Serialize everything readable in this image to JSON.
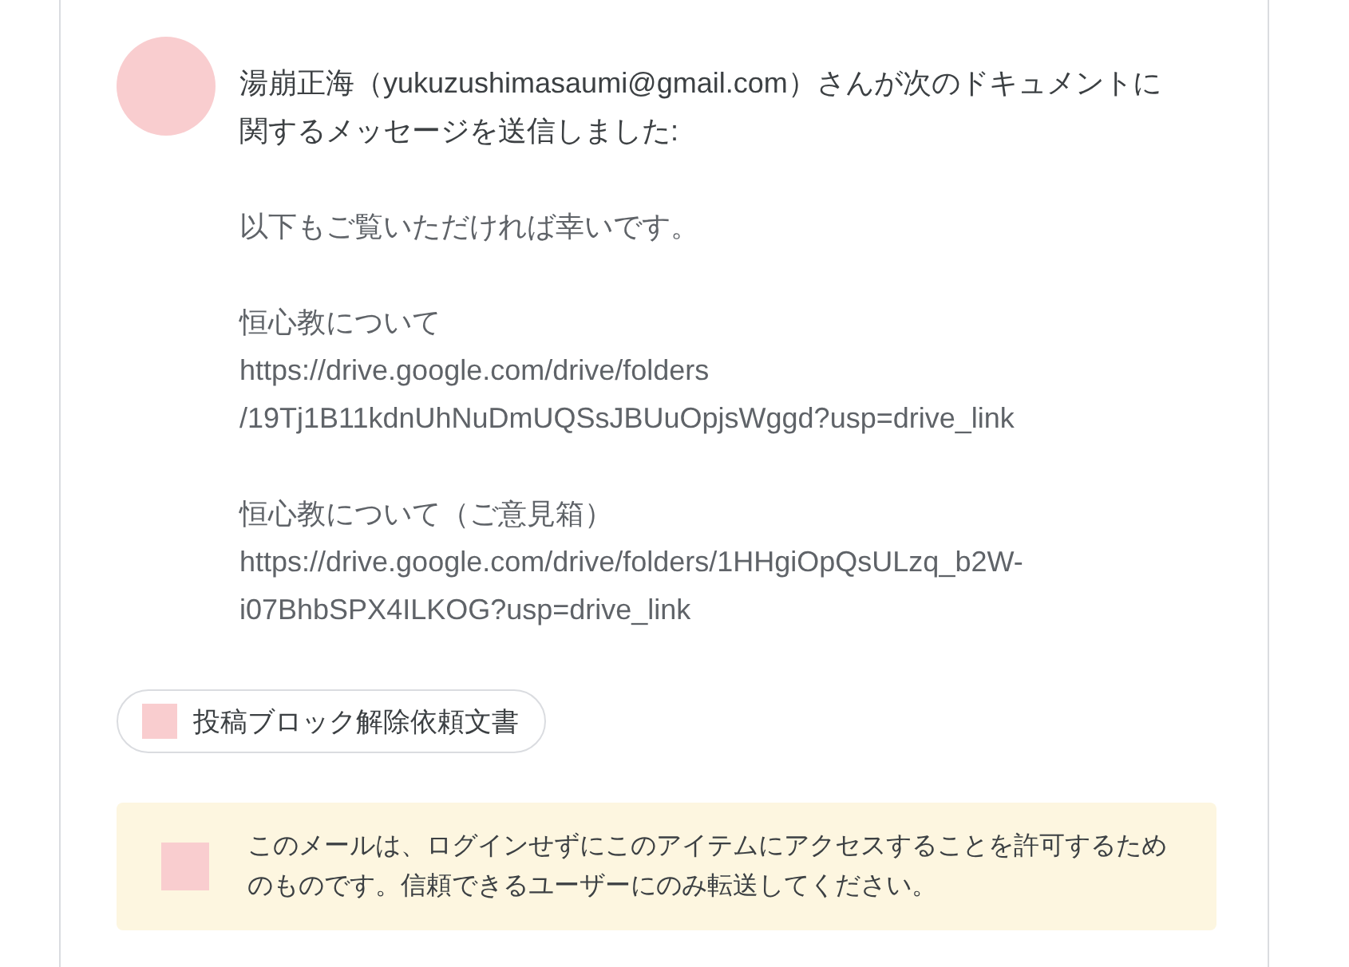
{
  "header": {
    "lines": [
      "湯崩正海（yukuzushimasaumi@gmail.com）さんが次のドキュメントに",
      "関するメッセージを送信しました:"
    ]
  },
  "message": {
    "paragraphs": [
      {
        "texts": [
          {
            "lines": [
              "以下もご覧いただければ幸いです。"
            ]
          }
        ]
      },
      {
        "texts": [
          {
            "lines": [
              "恒心教について"
            ]
          },
          {
            "lines": [
              "https://drive.google.com/drive/folders",
              "/19Tj1B11kdnUhNuDmUQSsJBUuOpjsWggd?usp=drive_link"
            ]
          }
        ]
      },
      {
        "texts": [
          {
            "lines": [
              "恒心教について（ご意見箱）"
            ]
          },
          {
            "lines": [
              "https://drive.google.com/drive/folders/1HHgiOpQsULzq_b2W-",
              "i07BhbSPX4ILKOG?usp=drive_link"
            ]
          }
        ]
      }
    ]
  },
  "attachment": {
    "label": "投稿ブロック解除依頼文書"
  },
  "notice": {
    "lines": [
      "このメールは、ログインせずにこのアイテムにアクセスすることを許可するため",
      "のものです。信頼できるユーザーにのみ転送してください。"
    ]
  }
}
